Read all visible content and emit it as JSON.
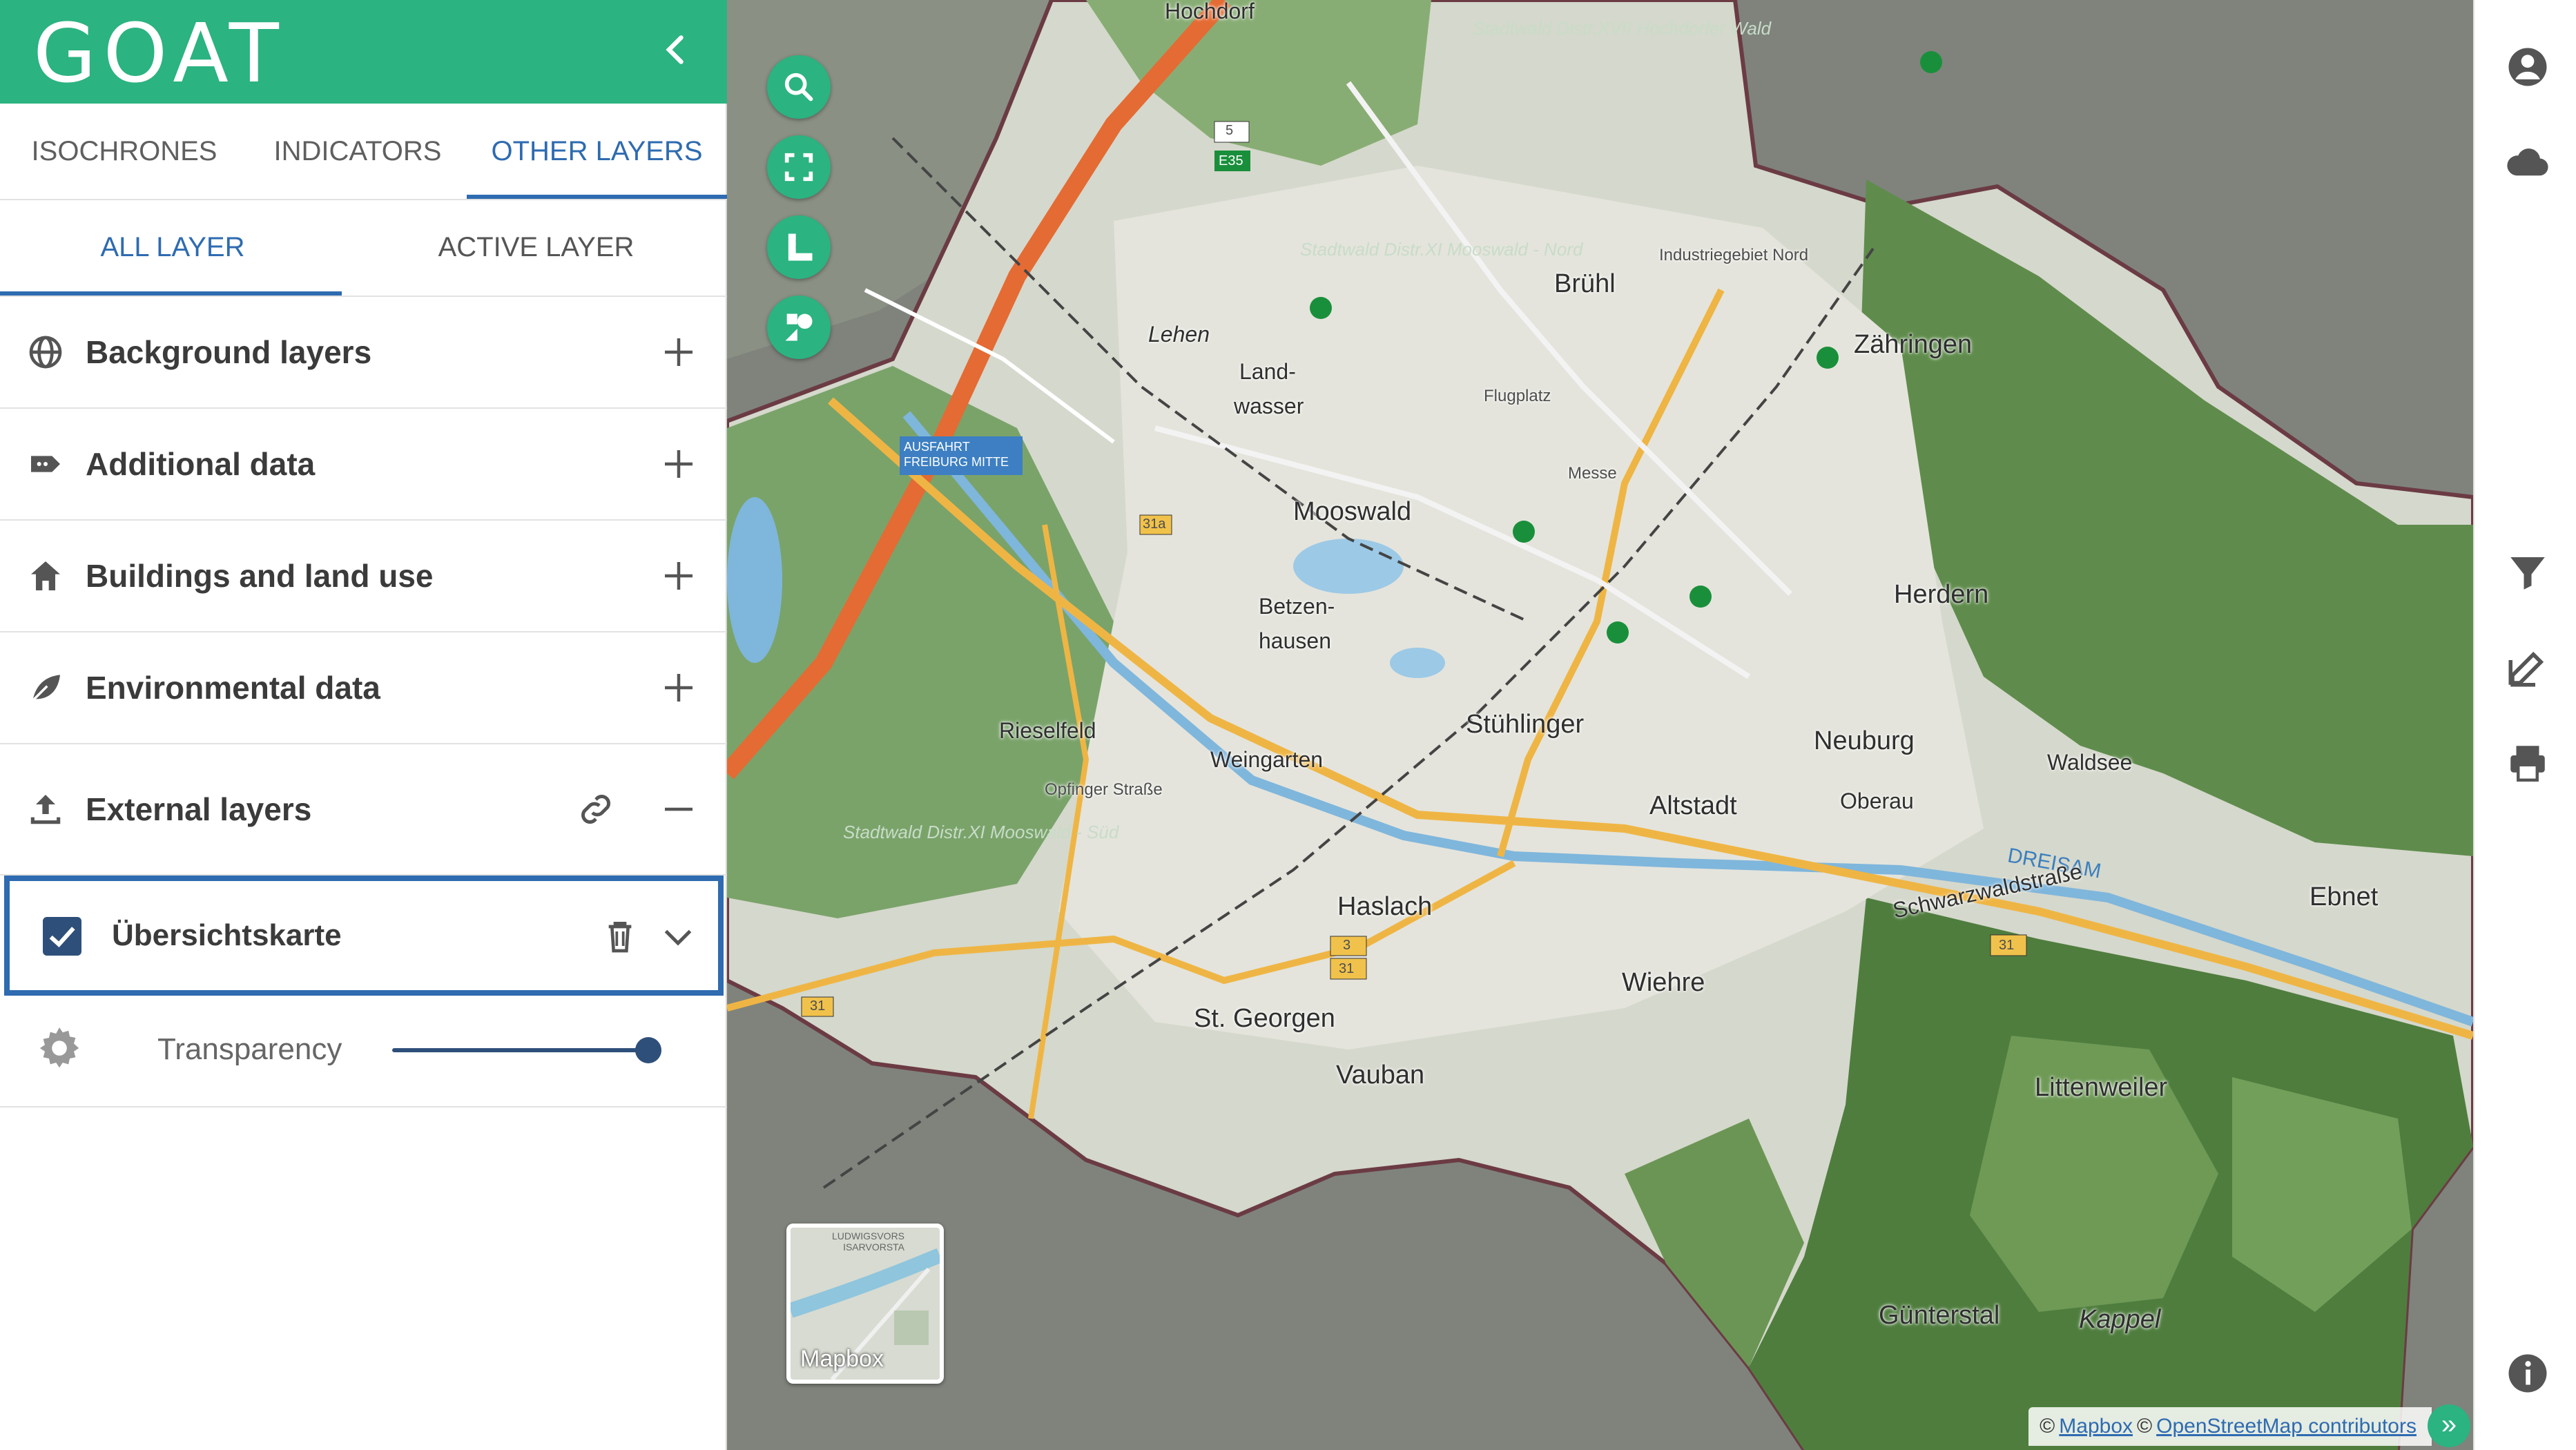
{
  "brand": {
    "logo": "GOAT"
  },
  "tabs": [
    {
      "label": "ISOCHRONES"
    },
    {
      "label": "INDICATORS"
    },
    {
      "label": "OTHER LAYERS"
    }
  ],
  "subtabs": [
    {
      "label": "ALL LAYER"
    },
    {
      "label": "ACTIVE LAYER"
    }
  ],
  "groups": [
    {
      "label": "Background layers",
      "icon": "globe-icon",
      "action": "expand"
    },
    {
      "label": "Additional data",
      "icon": "tag-icon",
      "action": "expand"
    },
    {
      "label": "Buildings and land use",
      "icon": "home-icon",
      "action": "expand"
    },
    {
      "label": "Environmental data",
      "icon": "leaf-icon",
      "action": "expand"
    },
    {
      "label": "External layers",
      "icon": "upload-icon",
      "action": "collapse"
    }
  ],
  "active_layer": {
    "name": "Übersichtskarte",
    "checked": true
  },
  "transparency": {
    "label": "Transparency",
    "value_percent": 100
  },
  "map": {
    "places": [
      "Hochdorf",
      "Lehen",
      "Land-",
      "wasser",
      "Mooswald",
      "Betzen-",
      "hausen",
      "Rieselfeld",
      "Weingarten",
      "Stühlinger",
      "Altstadt",
      "Haslach",
      "St. Georgen",
      "Vauban",
      "Wiehre",
      "Brühl",
      "Zähringen",
      "Herdern",
      "Neuburg",
      "Oberau",
      "Waldsee",
      "Ebnet",
      "Littenweiler",
      "Günterstal",
      "Kappel",
      "DREISAM",
      "Schwarzwaldstraße",
      "Industriegebiet Nord",
      "Messe",
      "Flugplatz",
      "Opfinger Straße",
      "Stadtwald Distr.XVII Hochdorfer Wald",
      "Stadtwald Distr.XI Mooswald - Süd",
      "Stadtwald Distr.XI Mooswald - Nord"
    ],
    "road_shields": [
      "5",
      "E35",
      "31a",
      "3",
      "31",
      "31",
      "31"
    ],
    "exit_sign": "AUSFAHRT FREIBURG MITTE",
    "minimap_label": "Mapbox",
    "minimap_caption": "LUDWIGSVORS\nISARVORSTA",
    "attribution": {
      "prefix": "©",
      "mapbox": "Mapbox",
      "mid": "©",
      "osm": "OpenStreetMap contributors"
    }
  },
  "rail_icons": [
    "account-icon",
    "cloud-icon",
    "filter-icon",
    "edit-icon",
    "print-icon",
    "info-icon"
  ],
  "colors": {
    "brand": "#2bb381",
    "accent": "#2e6bb0",
    "checkbox": "#2e4f7a"
  }
}
